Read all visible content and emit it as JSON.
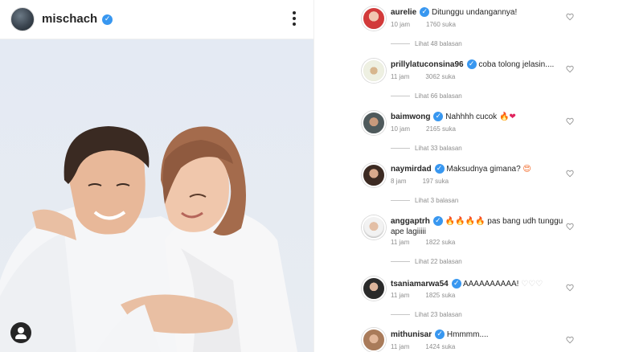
{
  "post": {
    "username": "mischach",
    "verified_icon": "verified-badge-icon",
    "photo_alt": "Couple photo",
    "menu_icon": "more-options-icon"
  },
  "comments": [
    {
      "user": "aurelie",
      "text": "Ditunggu undangannya!",
      "time": "10 jam",
      "likes": "1760 suka",
      "replies": "Lihat 48 balasan"
    },
    {
      "user": "prillylatuconsina96",
      "text": "coba tolong jelasin....",
      "time": "11 jam",
      "likes": "3062 suka",
      "replies": "Lihat 66 balasan"
    },
    {
      "user": "baimwong",
      "text": "Nahhhh cucok",
      "time": "10 jam",
      "likes": "2165 suka",
      "replies": "Lihat 33 balasan"
    },
    {
      "user": "naymirdad",
      "text": "Maksudnya gimana?",
      "time": "8 jam",
      "likes": "197 suka",
      "replies": "Lihat 3 balasan"
    },
    {
      "user": "anggaptrh",
      "text": "pas bang udh tunggu ape lagiiiii",
      "time": "11 jam",
      "likes": "1822 suka",
      "replies": "Lihat 22 balasan"
    },
    {
      "user": "tsaniamarwa54",
      "text": "AAAAAAAAAA!",
      "time": "11 jam",
      "likes": "1825 suka",
      "replies": "Lihat 23 balasan"
    },
    {
      "user": "mithunisar",
      "text": "Hmmmm....",
      "time": "11 jam",
      "likes": "1424 suka",
      "replies": ""
    }
  ],
  "emoji": {
    "fire": "🔥",
    "red_heart": "❤",
    "smile": "😍",
    "white_heart": "♡",
    "check": "✓"
  },
  "colors": {
    "verified": "#3897f0",
    "meta": "#8e8e8e",
    "text": "#262626"
  }
}
